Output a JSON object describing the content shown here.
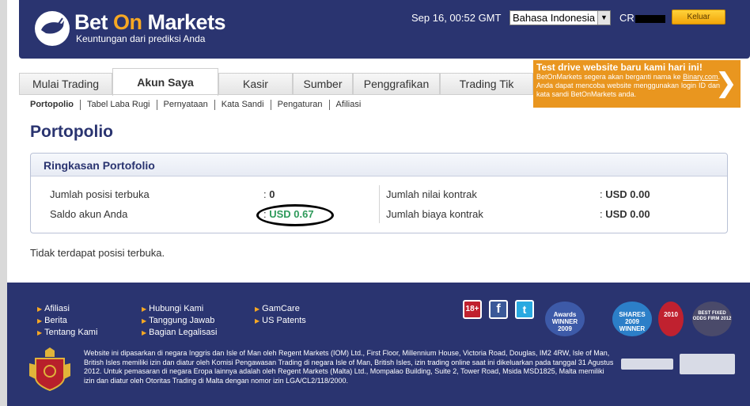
{
  "header": {
    "logo_pre": "Bet ",
    "logo_on": "On",
    "logo_post": " Markets",
    "tagline": "Keuntungan dari prediksi Anda",
    "date": "Sep 16, 00:52 GMT",
    "language": "Bahasa Indonesia",
    "account_prefix": "CR",
    "logout_label": "Keluar"
  },
  "promo": {
    "title": "Test drive website baru kami hari ini!",
    "body_pre": "BetOnMarkets segera akan berganti nama ke ",
    "link": "Binary.com",
    "body_post": ". Anda dapat mencoba website menggunakan login ID dan kata sandi BetOnMarkets anda."
  },
  "tabs": [
    {
      "label": "Mulai Trading"
    },
    {
      "label": "Akun Saya"
    },
    {
      "label": "Kasir"
    },
    {
      "label": "Sumber"
    },
    {
      "label": "Penggrafikan"
    },
    {
      "label": "Trading Tik"
    }
  ],
  "subnav": [
    "Portopolio",
    "Tabel Laba Rugi",
    "Pernyataan",
    "Kata Sandi",
    "Pengaturan",
    "Afiliasi"
  ],
  "page_title": "Portopolio",
  "summary": {
    "title": "Ringkasan Portofolio",
    "open_positions_label": "Jumlah posisi terbuka",
    "open_positions_value": "0",
    "balance_label": "Saldo akun Anda",
    "balance_value": "USD 0.67",
    "contract_value_label": "Jumlah nilai kontrak",
    "contract_value_value": "USD 0.00",
    "contract_cost_label": "Jumlah biaya kontrak",
    "contract_cost_value": "USD 0.00",
    "separator": ":",
    "balance_color": "#2e9a5a"
  },
  "no_positions": "Tidak terdapat posisi terbuka.",
  "footer": {
    "col1": [
      "Afiliasi",
      "Berita",
      "Tentang Kami"
    ],
    "col2": [
      "Hubungi Kami",
      "Tanggung Jawab",
      "Bagian Legalisasi"
    ],
    "col3": [
      "GamCare",
      "US Patents"
    ],
    "legal": "Website ini dipasarkan di negara Inggris dan Isle of Man oleh Regent Markets (IOM) Ltd., First Floor, Millennium House, Victoria Road, Douglas, IM2 4RW, Isle of Man, British Isles memiliki izin dan diatur oleh Komisi Pengawasan Trading di negara Isle of Man, British Isles, izin trading online saat ini dikeluarkan pada tanggal 31 Agustus 2012. Untuk pemasaran di negara Eropa lainnya adalah oleh Regent Markets (Malta) Ltd., Mompalao Building, Suite 2, Tower Road, Msida MSD1825, Malta memiliki izin dan diatur oleh Otoritas Trading di Malta dengan nomor izin LGA/CL2/118/2000.",
    "age_badge": "18+",
    "facebook": "f",
    "twitter": "t",
    "awards": [
      "Awards WINNER 2009",
      "SHARES 2009 WINNER",
      "2010",
      "BEST FIXED ODDS FIRM 2012"
    ]
  },
  "colors": {
    "navy": "#2a3470",
    "orange": "#e9961f",
    "accent_orange": "#f7a823"
  }
}
